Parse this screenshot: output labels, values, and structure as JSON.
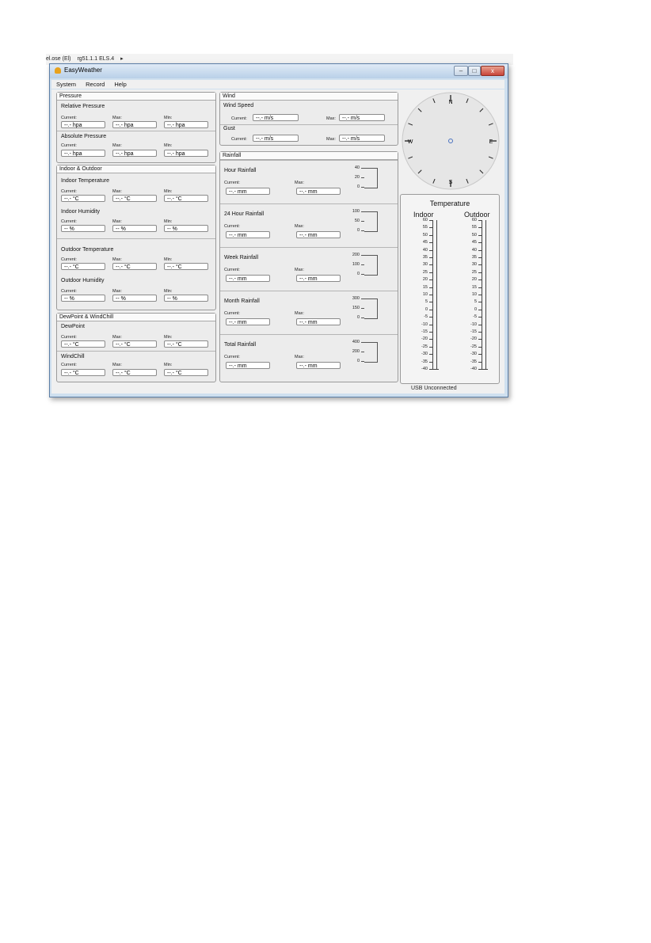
{
  "breadcrumb": {
    "a": "el.ose (El)",
    "b": "rg51.1.1 ELS.4",
    "c": "▸"
  },
  "window": {
    "title": "EasyWeather",
    "min": "–",
    "max": "□",
    "close": "x"
  },
  "menu": [
    "System",
    "Record",
    "Help"
  ],
  "labels": {
    "current": "Current:",
    "max": "Max:",
    "min": "Min:"
  },
  "pressure": {
    "title": "Pressure",
    "relative": {
      "title": "Relative Pressure",
      "current": "--.- hpa",
      "max": "--.- hpa",
      "min": "--.- hpa"
    },
    "absolute": {
      "title": "Absolute Pressure",
      "current": "--.- hpa",
      "max": "--.- hpa",
      "min": "--.- hpa"
    }
  },
  "indoor_outdoor": {
    "title": "Indoor & Outdoor",
    "indoor_temp": {
      "title": "Indoor Temperature",
      "current": "--.- °C",
      "max": "--.- °C",
      "min": "--.- °C"
    },
    "indoor_hum": {
      "title": "Indoor Humidity",
      "current": "-- %",
      "max": "-- %",
      "min": "-- %"
    },
    "outdoor_temp": {
      "title": "Outdoor Temperature",
      "current": "--.- °C",
      "max": "--.- °C",
      "min": "--.- °C"
    },
    "outdoor_hum": {
      "title": "Outdoor Humidity",
      "current": "-- %",
      "max": "-- %",
      "min": "-- %"
    }
  },
  "dewpoint": {
    "title": "DewPoint & WindChill",
    "dew": {
      "title": "DewPoint",
      "current": "--.- °C",
      "max": "--.- °C",
      "min": "--.- °C"
    },
    "chill": {
      "title": "WindChill",
      "current": "--.- °C",
      "max": "--.- °C",
      "min": "--.- °C"
    }
  },
  "wind": {
    "title": "Wind",
    "speed": {
      "title": "Wind Speed",
      "current": "--.- m/s",
      "max": "--.- m/s"
    },
    "gust": {
      "title": "Gust",
      "current": "--.- m/s",
      "max": "--.- m/s"
    }
  },
  "rainfall": {
    "title": "Rainfall",
    "hour": {
      "title": "Hour Rainfall",
      "current": "--.- mm",
      "max": "--.- mm",
      "scale": [
        "40",
        "20",
        "0"
      ]
    },
    "day": {
      "title": "24 Hour Rainfall",
      "current": "--.- mm",
      "max": "--.- mm",
      "scale": [
        "100",
        "50",
        "0"
      ]
    },
    "week": {
      "title": "Week Rainfall",
      "current": "--.- mm",
      "max": "--.- mm",
      "scale": [
        "200",
        "100",
        "0"
      ]
    },
    "month": {
      "title": "Month Rainfall",
      "current": "--.- mm",
      "max": "--.- mm",
      "scale": [
        "300",
        "150",
        "0"
      ]
    },
    "total": {
      "title": "Total Rainfall",
      "current": "--.- mm",
      "max": "--.- mm",
      "scale": [
        "400",
        "200",
        "0"
      ]
    }
  },
  "compass": {
    "n": "N",
    "s": "S",
    "e": "E",
    "w": "W"
  },
  "temperature": {
    "title": "Temperature",
    "indoor": "Indoor",
    "outdoor": "Outdoor",
    "ticks": [
      "60",
      "55",
      "50",
      "45",
      "40",
      "35",
      "30",
      "25",
      "20",
      "15",
      "10",
      "5",
      "0",
      "-5",
      "-10",
      "-15",
      "-20",
      "-25",
      "-30",
      "-35",
      "-40"
    ]
  },
  "status": "USB Unconnected"
}
